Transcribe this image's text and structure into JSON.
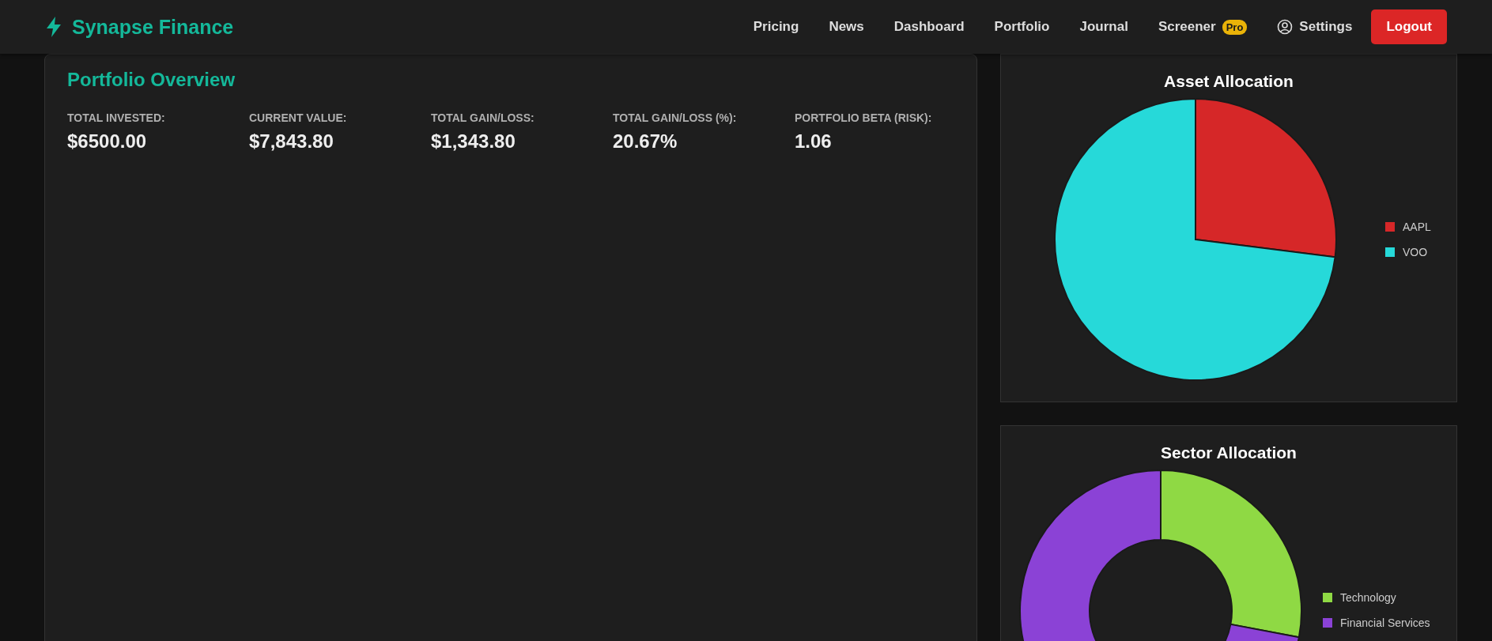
{
  "header": {
    "brand": "Synapse Finance",
    "nav": [
      {
        "label": "Pricing",
        "kind": "link"
      },
      {
        "label": "News",
        "kind": "link"
      },
      {
        "label": "Dashboard",
        "kind": "link"
      },
      {
        "label": "Portfolio",
        "kind": "link"
      },
      {
        "label": "Journal",
        "kind": "link"
      },
      {
        "label": "Screener",
        "kind": "link",
        "badge": "Pro"
      },
      {
        "label": "Settings",
        "kind": "account"
      }
    ],
    "logout": "Logout"
  },
  "overview": {
    "title": "Portfolio Overview",
    "stats": [
      {
        "label": "TOTAL INVESTED:",
        "value": "$6500.00"
      },
      {
        "label": "CURRENT VALUE:",
        "value": "$7,843.80"
      },
      {
        "label": "TOTAL GAIN/LOSS:",
        "value": "$1,343.80"
      },
      {
        "label": "TOTAL GAIN/LOSS (%):",
        "value": "20.67%"
      },
      {
        "label": "PORTFOLIO BETA (RISK):",
        "value": "1.06"
      }
    ]
  },
  "charts": [
    {
      "title": "Asset Allocation",
      "kind": "pie",
      "legend": [
        {
          "label": "AAPL",
          "color": "#d62728"
        },
        {
          "label": "VOO",
          "color": "#26d9d9"
        }
      ]
    },
    {
      "title": "Sector Allocation",
      "kind": "donut",
      "legend": [
        {
          "label": "Technology",
          "color": "#8fd944"
        },
        {
          "label": "Financial Services",
          "color": "#8b42d6"
        }
      ]
    }
  ]
}
